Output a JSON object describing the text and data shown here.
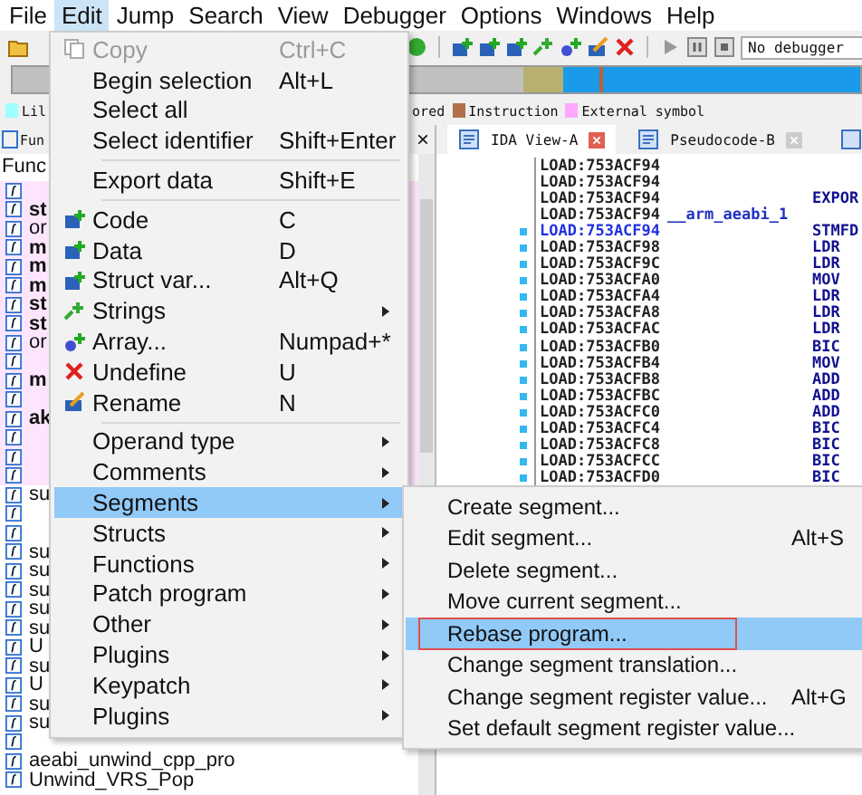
{
  "menubar": [
    {
      "label": "File",
      "selected": false
    },
    {
      "label": "Edit",
      "selected": true
    },
    {
      "label": "Jump",
      "selected": false
    },
    {
      "label": "Search",
      "selected": false
    },
    {
      "label": "View",
      "selected": false
    },
    {
      "label": "Debugger",
      "selected": false
    },
    {
      "label": "Options",
      "selected": false
    },
    {
      "label": "Windows",
      "selected": false
    },
    {
      "label": "Help",
      "selected": false
    }
  ],
  "toolbar": {
    "debugger_select": "No debugger"
  },
  "legend": [
    {
      "label": "Lil",
      "color": "#a0ffff"
    },
    {
      "label": "ored"
    },
    {
      "label": "Instruction",
      "color": "#b0704c"
    },
    {
      "label": "External symbol",
      "color": "#ffa8ff"
    }
  ],
  "functions_pane": {
    "tab": "Fun",
    "close": "×",
    "header": "Func",
    "rows": [
      {
        "library": true
      },
      {
        "text": "st",
        "library": true,
        "bold": true
      },
      {
        "text": "or",
        "library": true,
        "bold": false
      },
      {
        "text": "m",
        "library": true,
        "bold": true
      },
      {
        "text": "m",
        "library": true,
        "bold": true
      },
      {
        "text": "m",
        "library": true,
        "bold": true
      },
      {
        "text": "st",
        "library": true,
        "bold": true
      },
      {
        "text": "st",
        "library": true,
        "bold": true
      },
      {
        "text": "or",
        "library": true,
        "bold": false
      },
      {
        "library": true
      },
      {
        "text": "m",
        "library": true,
        "bold": true
      },
      {
        "library": true
      },
      {
        "text": "ak",
        "library": true,
        "bold": true
      },
      {
        "library": true
      },
      {
        "library": true
      },
      {
        "library": true
      },
      {
        "text": "su",
        "library": false,
        "bold": false
      },
      {
        "library": false
      },
      {
        "library": false
      },
      {
        "text": "su",
        "library": false,
        "bold": false
      },
      {
        "text": "su",
        "library": false,
        "bold": false
      },
      {
        "text": "su",
        "library": false,
        "bold": false
      },
      {
        "text": "su",
        "library": false,
        "bold": false
      },
      {
        "text": "su",
        "library": false,
        "bold": false
      },
      {
        "text": "U",
        "library": false,
        "bold": false
      },
      {
        "text": "su",
        "library": false,
        "bold": false
      },
      {
        "text": "U",
        "library": false,
        "bold": false
      },
      {
        "text": "su",
        "library": false,
        "bold": false
      },
      {
        "text": "su",
        "library": false,
        "bold": false
      },
      {
        "library": false
      },
      {
        "text": "aeabi_unwind_cpp_pro",
        "library": false,
        "bold": false
      },
      {
        "text": "Unwind_VRS_Pop",
        "library": false,
        "bold": false
      }
    ]
  },
  "view_tabs": [
    {
      "label": "IDA View-A",
      "selected": true
    },
    {
      "label": "Pseudocode-B",
      "selected": false
    }
  ],
  "listing": [
    {
      "address": "LOAD:753ACF94",
      "current": false,
      "dot": false
    },
    {
      "address": "LOAD:753ACF94",
      "current": false,
      "dot": false
    },
    {
      "address": "LOAD:753ACF94",
      "instruction": "EXPOR",
      "current": false,
      "dot": false
    },
    {
      "address": "LOAD:753ACF94",
      "label": "__arm_aeabi_1",
      "current": false,
      "dot": false
    },
    {
      "address": "LOAD:753ACF94",
      "instruction": "STMFD",
      "current": true,
      "dot": true
    },
    {
      "address": "LOAD:753ACF98",
      "instruction": "LDR",
      "current": false,
      "dot": true
    },
    {
      "address": "LOAD:753ACF9C",
      "instruction": "LDR",
      "current": false,
      "dot": true
    },
    {
      "address": "LOAD:753ACFA0",
      "instruction": "MOV",
      "current": false,
      "dot": true
    },
    {
      "address": "LOAD:753ACFA4",
      "instruction": "LDR",
      "current": false,
      "dot": true
    },
    {
      "address": "LOAD:753ACFA8",
      "instruction": "LDR",
      "current": false,
      "dot": true
    },
    {
      "address": "LOAD:753ACFAC",
      "instruction": "LDR",
      "current": false,
      "dot": true
    },
    {
      "address": "LOAD:753ACFB0",
      "instruction": "BIC",
      "current": false,
      "dot": true
    },
    {
      "address": "LOAD:753ACFB4",
      "instruction": "MOV",
      "current": false,
      "dot": true
    },
    {
      "address": "LOAD:753ACFB8",
      "instruction": "ADD",
      "current": false,
      "dot": true
    },
    {
      "address": "LOAD:753ACFBC",
      "instruction": "ADD",
      "current": false,
      "dot": true
    },
    {
      "address": "LOAD:753ACFC0",
      "instruction": "ADD",
      "current": false,
      "dot": true
    },
    {
      "address": "LOAD:753ACFC4",
      "instruction": "BIC",
      "current": false,
      "dot": true
    },
    {
      "address": "LOAD:753ACFC8",
      "instruction": "BIC",
      "current": false,
      "dot": true
    },
    {
      "address": "LOAD:753ACFCC",
      "instruction": "BIC",
      "current": false,
      "dot": true
    },
    {
      "address": "LOAD:753ACFD0",
      "instruction": "BIC",
      "current": false,
      "dot": true
    }
  ],
  "edit_menu": [
    {
      "kind": "item",
      "label": "Copy",
      "shortcut": "Ctrl+C",
      "disabled": true,
      "selected": false
    },
    {
      "kind": "item",
      "label": "Begin selection",
      "shortcut": "Alt+L",
      "disabled": false,
      "selected": false
    },
    {
      "kind": "item",
      "label": "Select all",
      "disabled": false,
      "selected": false
    },
    {
      "kind": "item",
      "label": "Select identifier",
      "shortcut": "Shift+Enter",
      "disabled": false,
      "selected": false
    },
    {
      "kind": "separator"
    },
    {
      "kind": "item",
      "label": "Export data",
      "shortcut": "Shift+E",
      "disabled": false,
      "selected": false
    },
    {
      "kind": "separator"
    },
    {
      "kind": "item",
      "label": "Code",
      "shortcut": "C",
      "disabled": false,
      "selected": false
    },
    {
      "kind": "item",
      "label": "Data",
      "shortcut": "D",
      "disabled": false,
      "selected": false
    },
    {
      "kind": "item",
      "label": "Struct var...",
      "shortcut": "Alt+Q",
      "disabled": false,
      "selected": false
    },
    {
      "kind": "submenu",
      "label": "Strings",
      "disabled": false,
      "selected": false
    },
    {
      "kind": "item",
      "label": "Array...",
      "shortcut": "Numpad+*",
      "disabled": false,
      "selected": false
    },
    {
      "kind": "item",
      "label": "Undefine",
      "shortcut": "U",
      "disabled": false,
      "selected": false
    },
    {
      "kind": "item",
      "label": "Rename",
      "shortcut": "N",
      "disabled": false,
      "selected": false
    },
    {
      "kind": "separator"
    },
    {
      "kind": "submenu",
      "label": "Operand type",
      "disabled": false,
      "selected": false
    },
    {
      "kind": "submenu",
      "label": "Comments",
      "disabled": false,
      "selected": false
    },
    {
      "kind": "submenu",
      "label": "Segments",
      "disabled": false,
      "selected": true
    },
    {
      "kind": "submenu",
      "label": "Structs",
      "disabled": false,
      "selected": false
    },
    {
      "kind": "submenu",
      "label": "Functions",
      "disabled": false,
      "selected": false
    },
    {
      "kind": "submenu",
      "label": "Patch program",
      "disabled": false,
      "selected": false
    },
    {
      "kind": "submenu",
      "label": "Other",
      "disabled": false,
      "selected": false
    },
    {
      "kind": "submenu",
      "label": "Plugins",
      "disabled": false,
      "selected": false
    },
    {
      "kind": "submenu",
      "label": "Keypatch",
      "disabled": false,
      "selected": false
    },
    {
      "kind": "submenu",
      "label": "Plugins",
      "disabled": false,
      "selected": false
    }
  ],
  "segments_menu": [
    {
      "label": "Create segment...",
      "selected": false,
      "outlined": false
    },
    {
      "label": "Edit segment...",
      "shortcut": "Alt+S",
      "selected": false,
      "outlined": false
    },
    {
      "label": "Delete segment...",
      "selected": false,
      "outlined": false
    },
    {
      "label": "Move current segment...",
      "selected": false,
      "outlined": false
    },
    {
      "label": "Rebase program...",
      "selected": true,
      "outlined": true
    },
    {
      "label": "Change segment translation...",
      "selected": false,
      "outlined": false
    },
    {
      "label": "Change segment register value...",
      "shortcut": "Alt+G",
      "selected": false,
      "outlined": false
    },
    {
      "label": "Set default segment register value...",
      "selected": false,
      "outlined": false
    }
  ]
}
